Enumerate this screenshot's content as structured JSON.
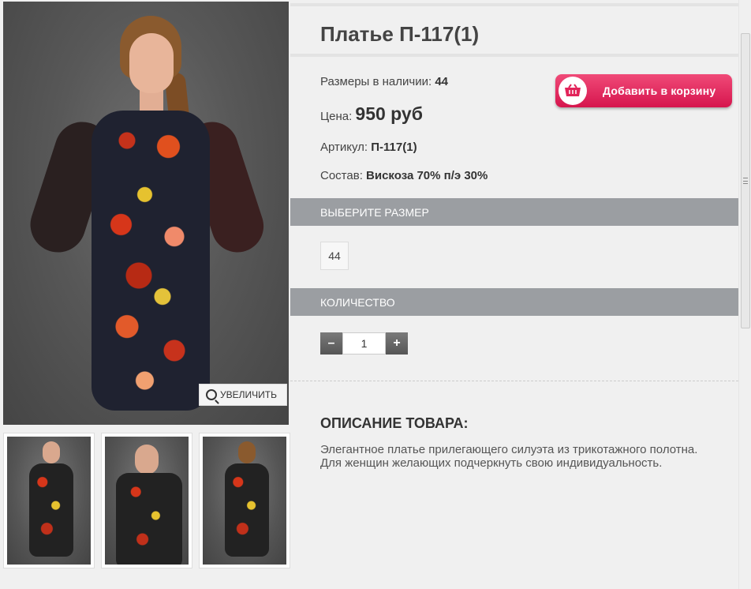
{
  "product": {
    "title": "Платье П-117(1)",
    "sizes_label": "Размеры в наличии:",
    "sizes_value": "44",
    "price_label": "Цена:",
    "price_value": "950 руб",
    "article_label": "Артикул:",
    "article_value": "П-117(1)",
    "composition_label": "Состав:",
    "composition_value": "Вискоза 70% п/э 30%"
  },
  "cart_button": {
    "label": "Добавить в корзину",
    "icon": "basket-icon",
    "color": "#e2245a"
  },
  "gallery": {
    "zoom_label": "УВЕЛИЧИТЬ",
    "zoom_icon": "magnifier-plus-icon",
    "thumbs_count": 3
  },
  "size_section": {
    "header": "ВЫБЕРИТЕ РАЗМЕР",
    "options": [
      "44"
    ]
  },
  "quantity_section": {
    "header": "КОЛИЧЕСТВО",
    "minus": "–",
    "plus": "+",
    "value": "1"
  },
  "description": {
    "title": "ОПИСАНИЕ ТОВАРА:",
    "text": "Элегантное платье прилегающего силуэта из трикотажного полотна. Для женщин желающих подчеркнуть свою индивидуальность."
  },
  "colors": {
    "section_bar": "#9b9ea2",
    "background": "#f0f0f0"
  }
}
